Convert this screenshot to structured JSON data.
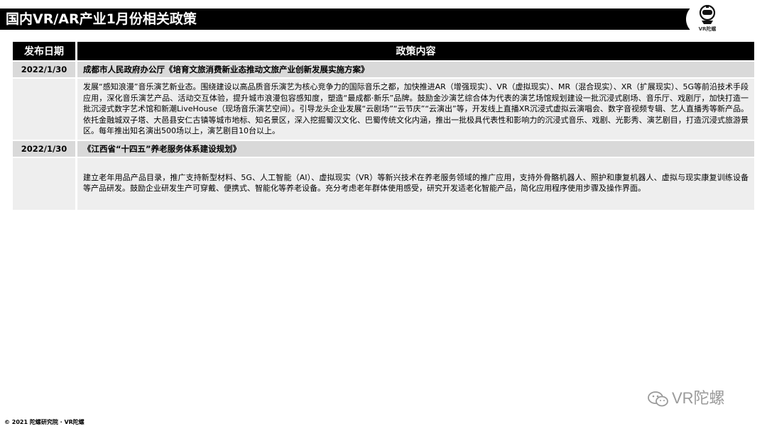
{
  "page": {
    "title": "国内VR/AR产业1月份相关政策",
    "logo_text": "VR陀螺"
  },
  "table": {
    "headers": [
      "发布日期",
      "政策内容"
    ],
    "rows": [
      {
        "date": "2022/1/30",
        "title": "成都市人民政府办公厅《培育文旅消费新业态推动文旅产业创新发展实施方案》",
        "content": "发展“感知浪漫”音乐演艺新业态。围绕建设以高品质音乐演艺为核心竞争力的国际音乐之都，加快推进AR（增强现实）、VR（虚拟现实）、MR（混合现实）、XR（扩展现实）、5G等前沿技术手段应用，深化音乐演艺产品、活动交互体验，提升城市浪漫包容感知度，塑造“最成都·新乐”品牌。鼓励金沙演艺综合体为代表的演艺场馆规划建设一批沉浸式剧场、音乐厅、戏剧厅，加快打造一批沉浸式数字艺术馆和新潮LiveHouse（现场音乐演艺空间）。引导龙头企业发展“云剧场”“云节庆”“云演出”等，开发线上直播XR沉浸式虚拟云演唱会、数字音视频专辑、艺人直播秀等新产品。依托金融城双子塔、大邑县安仁古镇等城市地标、知名景区，深入挖掘蜀汉文化、巴蜀传统文化内涵，推出一批极具代表性和影响力的沉浸式音乐、戏剧、光影秀、演艺剧目，打造沉浸式旅游景区。每年推出知名演出500场以上，演艺剧目10台以上。"
      },
      {
        "date": "2022/1/30",
        "title": "《江西省“十四五”养老服务体系建设规划》",
        "content": "建立老年用品产品目录，推广支持新型材料、5G、人工智能（AI）、虚拟现实（VR）等新兴技术在养老服务领域的推广应用，支持外骨骼机器人、照护和康复机器人、虚拟与现实康复训练设备等产品研发。鼓励企业研发生产可穿戴、便携式、智能化等养老设备。充分考虑老年群体使用感受，研究开发适老化智能产品，简化应用程序使用步骤及操作界面。"
      }
    ]
  },
  "watermark": {
    "text": "VR陀螺",
    "icon": "wechat-icon"
  },
  "footer": {
    "text": "© 2021  陀螺研究院 · VR陀螺"
  }
}
